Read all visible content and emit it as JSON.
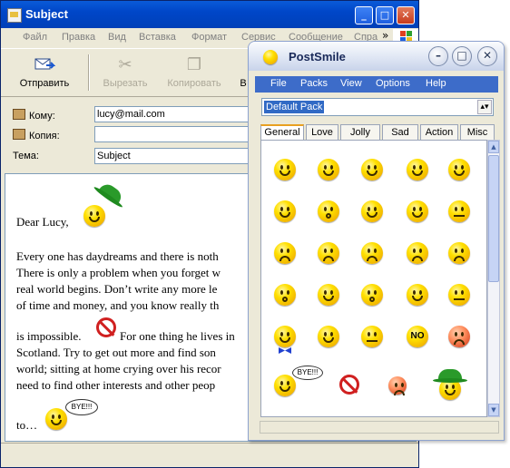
{
  "oe": {
    "title": "Subject",
    "menu": [
      "Файл",
      "Правка",
      "Вид",
      "Вставка",
      "Формат",
      "Сервис",
      "Сообщение",
      "Спра"
    ],
    "menu_more": "»",
    "toolbar": {
      "send": "Отправить",
      "cut": "Вырезать",
      "copy": "Копировать",
      "partial": "В"
    },
    "headers": {
      "to_label": "Кому:",
      "to_value": "lucy@mail.com",
      "cc_label": "Копия:",
      "cc_value": "",
      "subject_label": "Тема:",
      "subject_value": "Subject"
    },
    "body": {
      "greeting": "Dear Lucy,",
      "lines": [
        "Every one has daydreams and there is noth",
        "There is only a problem when you forget w",
        "real world begins. Don’t write any more le",
        "of time and money, and you know really th",
        "",
        "is impossible.",
        "Scotland. Try to get out more and find son",
        "world; sitting at home crying over his recor",
        "need to find other interests and other peop"
      ],
      "line6_cont": "For one thing he lives in",
      "sign": "to…",
      "bubble": "BYE!!!"
    }
  },
  "ps": {
    "title": "PostSmile",
    "menu": [
      "File",
      "Packs",
      "View",
      "Options",
      "Help"
    ],
    "pack": "Default Pack",
    "tabs": [
      "General",
      "Love",
      "Jolly",
      "Sad",
      "Action",
      "Misc"
    ],
    "active_tab": "General",
    "grid_bubble": "BYE!!!",
    "no_sign_text": "NO"
  }
}
